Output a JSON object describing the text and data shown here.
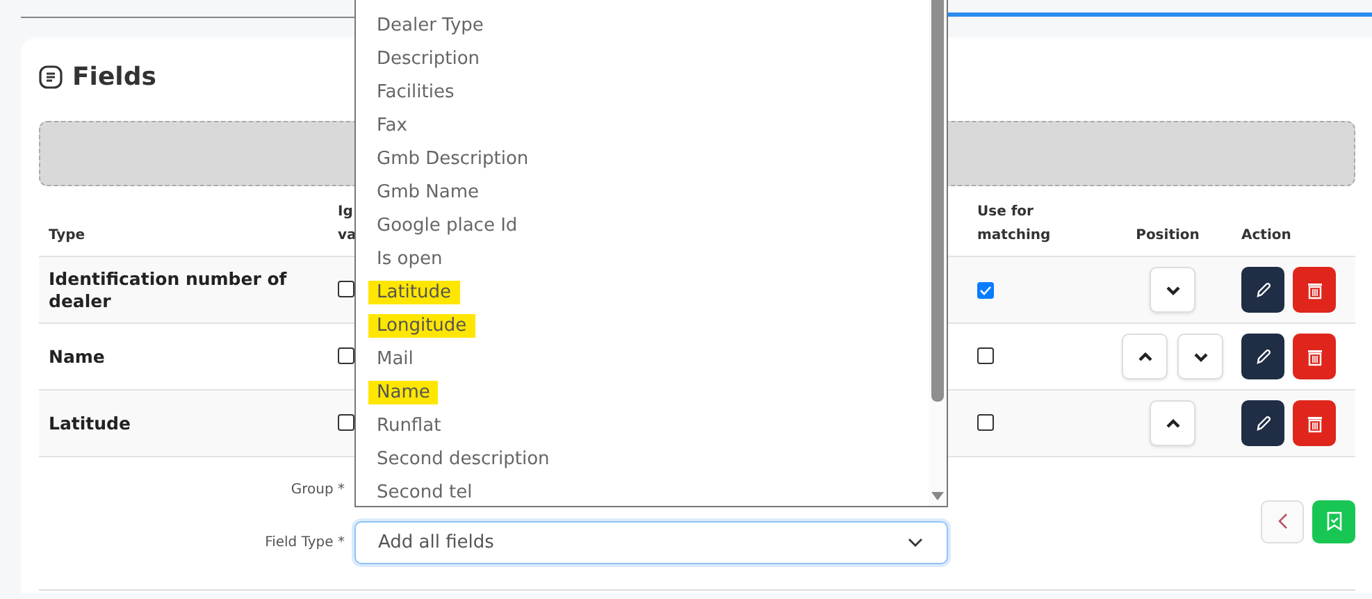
{
  "card": {
    "title": "Fields"
  },
  "table": {
    "columns": [
      {
        "kind": "type",
        "lines": [
          "Type"
        ]
      },
      {
        "kind": "ignore",
        "lines": [
          "Ig",
          "va"
        ]
      },
      {
        "kind": "match",
        "lines": [
          "Use for",
          "matching"
        ]
      },
      {
        "kind": "position",
        "lines": [
          "Position"
        ]
      },
      {
        "kind": "action",
        "lines": [
          "Action"
        ]
      }
    ],
    "rows": [
      {
        "type": "Identification number of dealer",
        "ignore_checked": false,
        "use_for_matching": true,
        "can_move_up": false,
        "can_move_down": true
      },
      {
        "type": "Name",
        "ignore_checked": false,
        "use_for_matching": false,
        "can_move_up": true,
        "can_move_down": true
      },
      {
        "type": "Latitude",
        "ignore_checked": false,
        "use_for_matching": false,
        "can_move_up": true,
        "can_move_down": false
      }
    ]
  },
  "form": {
    "group_label": "Group *",
    "field_type_label": "Field Type *",
    "field_type_value": "Add all fields"
  },
  "dropdown": {
    "options": [
      {
        "label": "Dealer Type",
        "highlighted": false
      },
      {
        "label": "Description",
        "highlighted": false
      },
      {
        "label": "Facilities",
        "highlighted": false
      },
      {
        "label": "Fax",
        "highlighted": false
      },
      {
        "label": "Gmb Description",
        "highlighted": false
      },
      {
        "label": "Gmb Name",
        "highlighted": false
      },
      {
        "label": "Google place Id",
        "highlighted": false
      },
      {
        "label": "Is open",
        "highlighted": false
      },
      {
        "label": "Latitude",
        "highlighted": true
      },
      {
        "label": "Longitude",
        "highlighted": true
      },
      {
        "label": "Mail",
        "highlighted": false
      },
      {
        "label": "Name",
        "highlighted": true
      },
      {
        "label": "Runflat",
        "highlighted": false
      },
      {
        "label": "Second description",
        "highlighted": false
      },
      {
        "label": "Second tel",
        "highlighted": false
      }
    ]
  }
}
